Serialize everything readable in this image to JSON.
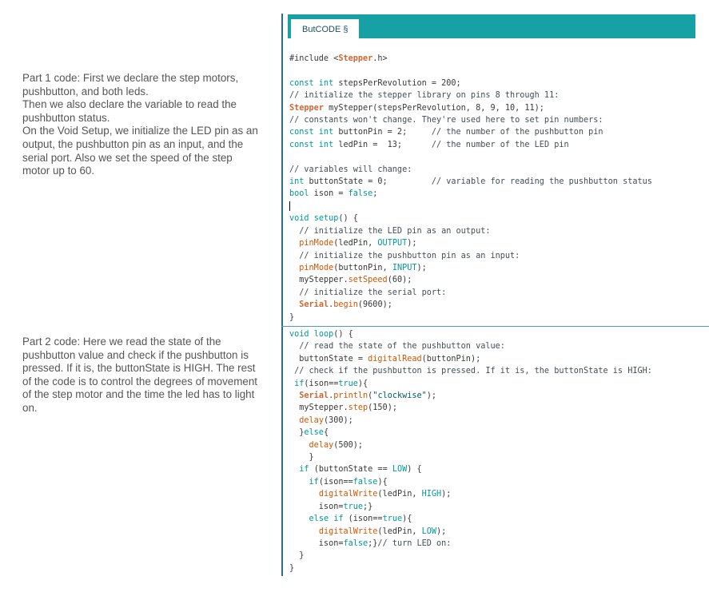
{
  "tab": {
    "label": "ButCODE §"
  },
  "descriptions": {
    "part1": [
      "Part 1 code: First we declare the step motors, pushbutton, and both leds.",
      "Then we also declare the variable to read the pushbutton status.",
      "On the Void Setup, we initialize the LED pin as an output, the pushbutton pin as an input, and the serial port. Also we set the speed of the step motor up to 60."
    ],
    "part2": [
      "Part 2 code: Here we read the state of the pushbutton value and check if the pushbutton is pressed. If it is, the buttonState is HIGH. The rest of the code is to control the degrees of movement of the step motor and the time the led has to light on."
    ]
  },
  "code_part1": [
    [
      [
        "",
        "#include <"
      ],
      [
        "ty",
        "Stepper"
      ],
      [
        "",
        ".h>"
      ]
    ],
    [],
    [
      [
        "kw",
        "const int"
      ],
      [
        "",
        " stepsPerRevolution = 200;"
      ]
    ],
    [
      [
        "cm",
        "// initialize the stepper library on pins 8 through 11:"
      ]
    ],
    [
      [
        "ty",
        "Stepper"
      ],
      [
        "",
        " myStepper(stepsPerRevolution, 8, 9, 10, 11);"
      ]
    ],
    [
      [
        "cm",
        "// constants won't change. They're used here to set pin numbers:"
      ]
    ],
    [
      [
        "kw",
        "const int"
      ],
      [
        "",
        " buttonPin = 2;     "
      ],
      [
        "cm",
        "// the number of the pushbutton pin"
      ]
    ],
    [
      [
        "kw",
        "const int"
      ],
      [
        "",
        " ledPin =  13;      "
      ],
      [
        "cm",
        "// the number of the LED pin"
      ]
    ],
    [],
    [
      [
        "cm",
        "// variables will change:"
      ]
    ],
    [
      [
        "kw",
        "int"
      ],
      [
        "",
        " buttonState = 0;         "
      ],
      [
        "cm",
        "// variable for reading the pushbutton status"
      ]
    ],
    [
      [
        "kw",
        "bool"
      ],
      [
        "",
        " ison = "
      ],
      [
        "kw",
        "false"
      ],
      [
        "",
        ";"
      ]
    ],
    [],
    [
      [
        "kw",
        "void"
      ],
      [
        "",
        " "
      ],
      [
        "kw",
        "setup"
      ],
      [
        "",
        "() {"
      ]
    ],
    [
      [
        "cm",
        "  // initialize the LED pin as an output:"
      ]
    ],
    [
      [
        "",
        "  "
      ],
      [
        "fn",
        "pinMode"
      ],
      [
        "",
        "(ledPin, "
      ],
      [
        "kw",
        "OUTPUT"
      ],
      [
        "",
        ");"
      ]
    ],
    [
      [
        "cm",
        "  // initialize the pushbutton pin as an input:"
      ]
    ],
    [
      [
        "",
        "  "
      ],
      [
        "fn",
        "pinMode"
      ],
      [
        "",
        "(buttonPin, "
      ],
      [
        "kw",
        "INPUT"
      ],
      [
        "",
        ");"
      ]
    ],
    [
      [
        "",
        "  myStepper."
      ],
      [
        "fn",
        "setSpeed"
      ],
      [
        "",
        "(60);"
      ]
    ],
    [
      [
        "cm",
        "  // initialize the serial port:"
      ]
    ],
    [
      [
        "",
        "  "
      ],
      [
        "ty",
        "Serial"
      ],
      [
        "",
        "."
      ],
      [
        "fn",
        "begin"
      ],
      [
        "",
        "(9600);"
      ]
    ],
    [
      [
        "",
        "}"
      ]
    ]
  ],
  "code_part2": [
    [
      [
        "kw",
        "void"
      ],
      [
        "",
        " "
      ],
      [
        "kw",
        "loop"
      ],
      [
        "",
        "() {"
      ]
    ],
    [
      [
        "cm",
        "  // read the state of the pushbutton value:"
      ]
    ],
    [
      [
        "",
        "  buttonState = "
      ],
      [
        "fn",
        "digitalRead"
      ],
      [
        "",
        "(buttonPin);"
      ]
    ],
    [
      [
        "cm",
        " // check if the pushbutton is pressed. If it is, the buttonState is HIGH:"
      ]
    ],
    [
      [
        "",
        " "
      ],
      [
        "kw",
        "if"
      ],
      [
        "",
        "(ison=="
      ],
      [
        "kw",
        "true"
      ],
      [
        "",
        "){"
      ]
    ],
    [
      [
        "",
        "  "
      ],
      [
        "ty",
        "Serial"
      ],
      [
        "",
        "."
      ],
      [
        "fn",
        "println"
      ],
      [
        "",
        "("
      ],
      [
        "st",
        "\"clockwise\""
      ],
      [
        "",
        ");"
      ]
    ],
    [
      [
        "",
        "  myStepper."
      ],
      [
        "fn",
        "step"
      ],
      [
        "",
        "(150);"
      ]
    ],
    [
      [
        "",
        "  "
      ],
      [
        "fn",
        "delay"
      ],
      [
        "",
        "(300);"
      ]
    ],
    [
      [
        "",
        "  }"
      ],
      [
        "kw",
        "else"
      ],
      [
        "",
        "{"
      ]
    ],
    [
      [
        "",
        "    "
      ],
      [
        "fn",
        "delay"
      ],
      [
        "",
        "(500);"
      ]
    ],
    [
      [
        "",
        "    }"
      ]
    ],
    [
      [
        "",
        "  "
      ],
      [
        "kw",
        "if"
      ],
      [
        "",
        " (buttonState == "
      ],
      [
        "kw",
        "LOW"
      ],
      [
        "",
        ") {"
      ]
    ],
    [
      [
        "",
        "    "
      ],
      [
        "kw",
        "if"
      ],
      [
        "",
        "(ison=="
      ],
      [
        "kw",
        "false"
      ],
      [
        "",
        "){"
      ]
    ],
    [
      [
        "",
        "      "
      ],
      [
        "fn",
        "digitalWrite"
      ],
      [
        "",
        "(ledPin, "
      ],
      [
        "kw",
        "HIGH"
      ],
      [
        "",
        ");"
      ]
    ],
    [
      [
        "",
        "      ison="
      ],
      [
        "kw",
        "true"
      ],
      [
        "",
        ";}"
      ]
    ],
    [
      [
        "",
        "    "
      ],
      [
        "kw",
        "else if"
      ],
      [
        "",
        " (ison=="
      ],
      [
        "kw",
        "true"
      ],
      [
        "",
        "){"
      ]
    ],
    [
      [
        "",
        "      "
      ],
      [
        "fn",
        "digitalWrite"
      ],
      [
        "",
        "(ledPin, "
      ],
      [
        "kw",
        "LOW"
      ],
      [
        "",
        ");"
      ]
    ],
    [
      [
        "",
        "      ison="
      ],
      [
        "kw",
        "false"
      ],
      [
        "",
        ";}"
      ],
      [
        "cm",
        "// turn LED on:"
      ]
    ],
    [
      [
        "",
        "  }"
      ]
    ],
    [
      [
        "",
        "}"
      ]
    ]
  ]
}
